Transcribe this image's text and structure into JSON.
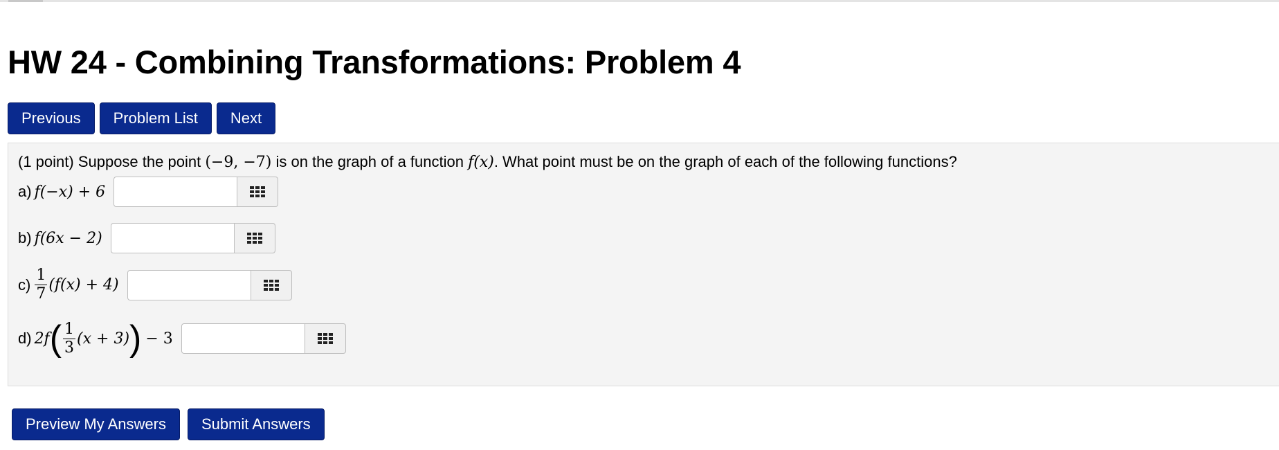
{
  "title": "HW 24 - Combining Transformations: Problem 4",
  "nav": {
    "previous": "Previous",
    "problem_list": "Problem List",
    "next": "Next"
  },
  "problem": {
    "statement_prefix": "(1 point) Suppose the point",
    "point": "(−9, −7)",
    "statement_middle": "is on the graph of a function",
    "function": "f(x)",
    "statement_suffix": ". What point must be on the graph of each of the following functions?",
    "parts": {
      "a": {
        "label": "a)",
        "expr": "f(−x) + 6",
        "value": ""
      },
      "b": {
        "label": "b)",
        "expr": "f(6x − 2)",
        "value": ""
      },
      "c": {
        "label": "c)",
        "num": "1",
        "den": "7",
        "rest": "(f(x) + 4)",
        "value": ""
      },
      "d": {
        "label": "d)",
        "lead": "2f",
        "num": "1",
        "den": "3",
        "inner": "(x + 3)",
        "tail": "− 3",
        "value": ""
      }
    }
  },
  "actions": {
    "preview": "Preview My Answers",
    "submit": "Submit Answers"
  },
  "colors": {
    "button_bg": "#0a2a8e",
    "panel_bg": "#f4f4f4"
  }
}
